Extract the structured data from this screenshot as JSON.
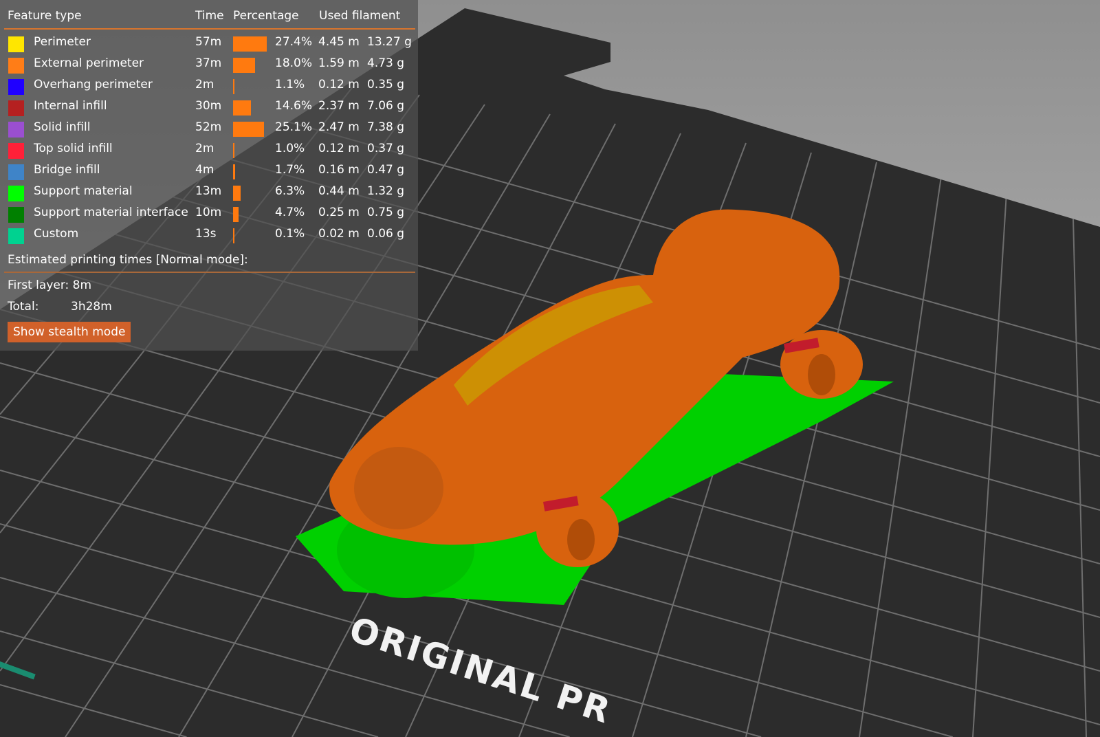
{
  "legend": {
    "headers": {
      "feature": "Feature type",
      "time": "Time",
      "percentage": "Percentage",
      "filament": "Used filament"
    },
    "rows": [
      {
        "label": "Perimeter",
        "color": "#ffe600",
        "time": "57m",
        "percent": 27.4,
        "percent_text": "27.4%",
        "length": "4.45 m",
        "weight": "13.27 g"
      },
      {
        "label": "External perimeter",
        "color": "#ff7d17",
        "time": "37m",
        "percent": 18.0,
        "percent_text": "18.0%",
        "length": "1.59 m",
        "weight": "4.73 g"
      },
      {
        "label": "Overhang perimeter",
        "color": "#1f00ff",
        "time": "2m",
        "percent": 1.1,
        "percent_text": "1.1%",
        "length": "0.12 m",
        "weight": "0.35 g"
      },
      {
        "label": "Internal infill",
        "color": "#b52020",
        "time": "30m",
        "percent": 14.6,
        "percent_text": "14.6%",
        "length": "2.37 m",
        "weight": "7.06 g"
      },
      {
        "label": "Solid infill",
        "color": "#9a4fd0",
        "time": "52m",
        "percent": 25.1,
        "percent_text": "25.1%",
        "length": "2.47 m",
        "weight": "7.38 g"
      },
      {
        "label": "Top solid infill",
        "color": "#ff2038",
        "time": "2m",
        "percent": 1.0,
        "percent_text": "1.0%",
        "length": "0.12 m",
        "weight": "0.37 g"
      },
      {
        "label": "Bridge infill",
        "color": "#3f84c8",
        "time": "4m",
        "percent": 1.7,
        "percent_text": "1.7%",
        "length": "0.16 m",
        "weight": "0.47 g"
      },
      {
        "label": "Support material",
        "color": "#00ff00",
        "time": "13m",
        "percent": 6.3,
        "percent_text": "6.3%",
        "length": "0.44 m",
        "weight": "1.32 g"
      },
      {
        "label": "Support material interface",
        "color": "#008000",
        "time": "10m",
        "percent": 4.7,
        "percent_text": "4.7%",
        "length": "0.25 m",
        "weight": "0.75 g"
      },
      {
        "label": "Custom",
        "color": "#00d290",
        "time": "13s",
        "percent": 0.1,
        "percent_text": "0.1%",
        "length": "0.02 m",
        "weight": "0.06 g"
      }
    ],
    "estimated_title": "Estimated printing times [Normal mode]:",
    "first_layer": "First layer: 8m",
    "total_label": "Total:",
    "total_value": "3h28m",
    "stealth_button": "Show stealth mode"
  },
  "bed_label": "ORIGINAL PR"
}
